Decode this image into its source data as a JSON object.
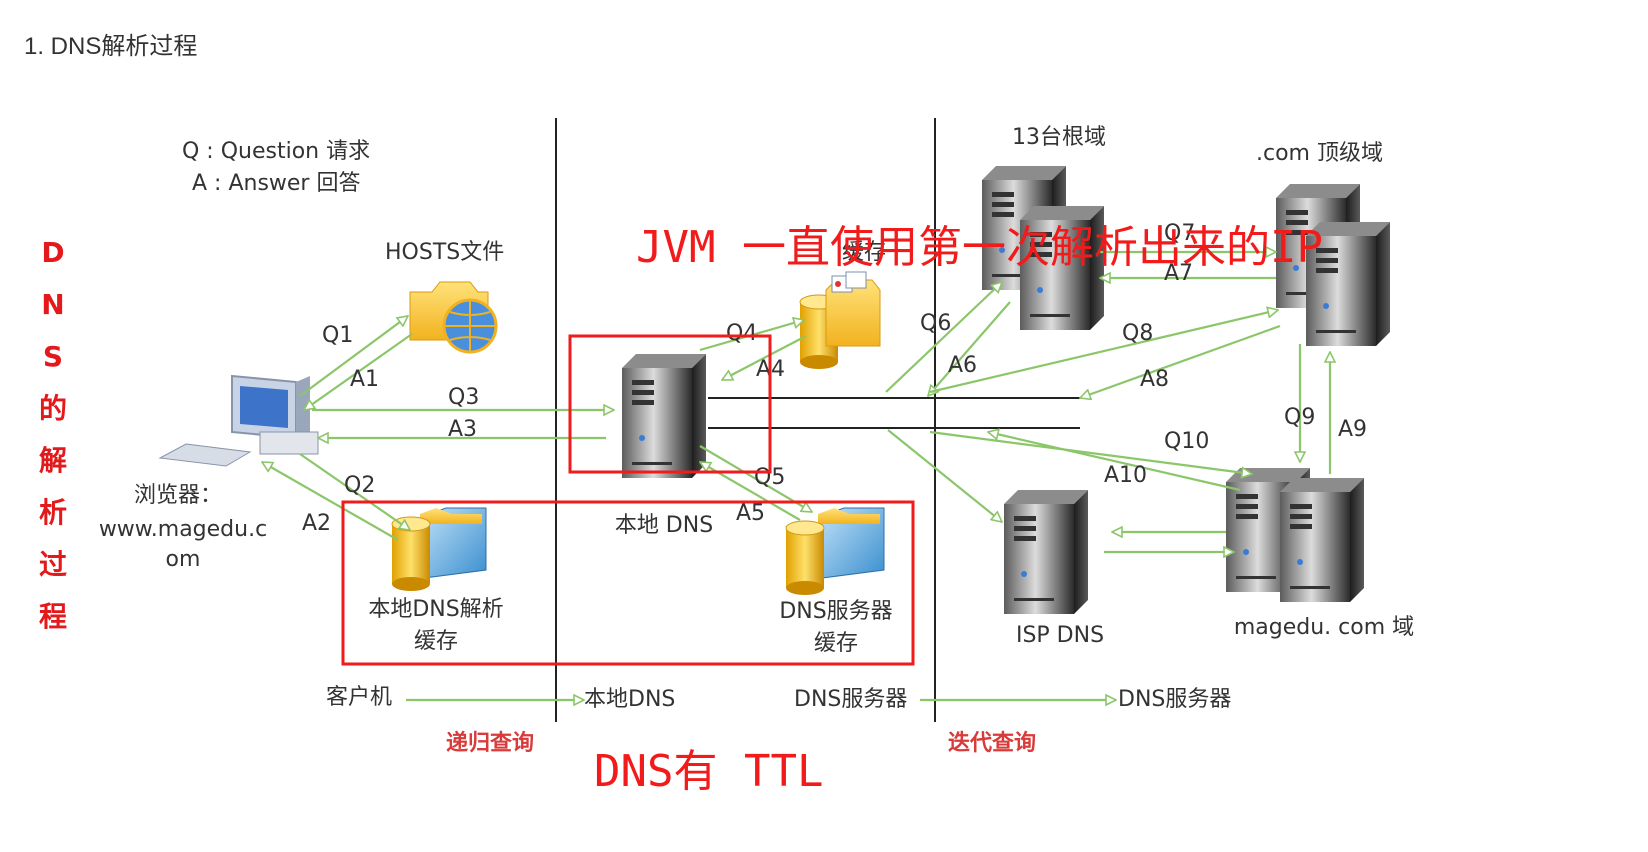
{
  "page": {
    "heading": "1. DNS解析过程"
  },
  "legend": {
    "q": "Q : Question 请求",
    "a": "A : Answer 回答"
  },
  "side_title": [
    "D",
    "N",
    "S",
    "的",
    "解",
    "析",
    "过",
    "程"
  ],
  "nodes": {
    "hosts": "HOSTS文件",
    "browser_line1": "浏览器：",
    "browser_line2": "www.magedu.c",
    "browser_line3": "om",
    "local_cache_line1": "本地DNS解析",
    "local_cache_line2": "缓存",
    "local_dns": "本地 DNS",
    "server_cache_line1": "DNS服务器",
    "server_cache_line2": "缓存",
    "root": "13台根域",
    "com": ".com 顶级域",
    "isp": "ISP DNS",
    "magedu": "magedu. com 域"
  },
  "arrows": {
    "q1": "Q1",
    "a1": "A1",
    "q2": "Q2",
    "a2": "A2",
    "q3": "Q3",
    "a3": "A3",
    "q4": "Q4",
    "a4": "A4",
    "q5": "Q5",
    "a5": "A5",
    "q6": "Q6",
    "a6": "A6",
    "q7": "Q7",
    "a7": "A7",
    "q8": "Q8",
    "a8": "A8",
    "q9": "Q9",
    "a9": "A9",
    "q10": "Q10",
    "a10": "A10"
  },
  "bottom": {
    "client": "客户机",
    "local_dns": "本地DNS",
    "dns_server_1": "DNS服务器",
    "dns_server_2": "DNS服务器",
    "recursive": "递归查询",
    "iterative": "迭代查询"
  },
  "annotations": {
    "jvm": "JVM 一直使用第一次解析出来的IP",
    "ttl": "DNS有 TTL",
    "hidden_label": "缓存"
  },
  "colors": {
    "arrow": "#8cc66a",
    "annotation": "#f21b1b",
    "side_title": "#e3191c",
    "divider": "#222222",
    "heading": "#333333"
  }
}
